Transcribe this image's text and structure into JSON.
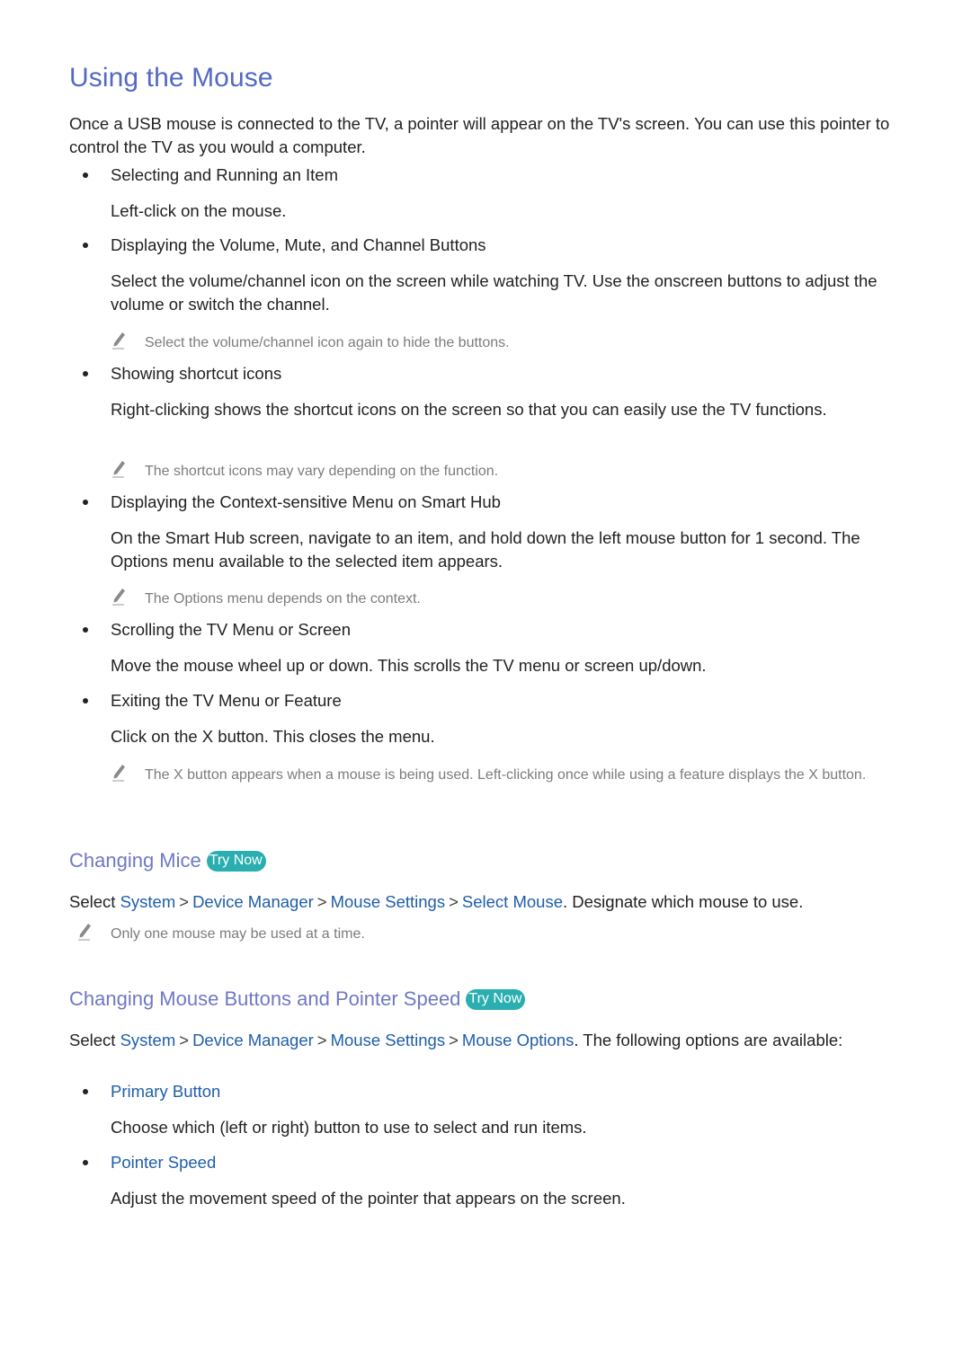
{
  "title": "Using the Mouse",
  "intro": "Once a USB mouse is connected to the TV, a pointer will appear on the TV's screen. You can use this pointer to control the TV as you would a computer.",
  "items": [
    {
      "heading": "Selecting and Running an Item",
      "text": "Left-click on the mouse.",
      "note": ""
    },
    {
      "heading": "Displaying the Volume, Mute, and Channel Buttons",
      "text": "Select the volume/channel icon on the screen while watching TV. Use the onscreen buttons to adjust the volume or switch the channel.",
      "note": "Select the volume/channel icon again to hide the buttons."
    },
    {
      "heading": "Showing shortcut icons",
      "text": "Right-clicking shows the shortcut icons on the screen so that you can easily use the TV functions.",
      "note": "The shortcut icons may vary depending on the function."
    },
    {
      "heading": "Displaying the Context-sensitive Menu on Smart Hub",
      "text": "On the Smart Hub screen, navigate to an item, and hold down the left mouse button for 1 second. The Options menu available to the selected item appears.",
      "note": "The Options menu depends on the context."
    },
    {
      "heading": "Scrolling the TV Menu or Screen",
      "text": "Move the mouse wheel up or down. This scrolls the TV menu or screen up/down.",
      "note": ""
    },
    {
      "heading": "Exiting the TV Menu or Feature",
      "text": "Click on the X button. This closes the menu.",
      "note": "The X button appears when a mouse is being used. Left-clicking once while using a feature displays the X button."
    }
  ],
  "section_mice": {
    "title": "Changing Mice",
    "try_now": "Try Now",
    "select_label": "Select",
    "path": [
      "System",
      "Device Manager",
      "Mouse Settings",
      "Select Mouse"
    ],
    "separator": ">",
    "suffix": ". Designate which mouse to use.",
    "note": "Only one mouse may be used at a time."
  },
  "section_buttons": {
    "title": "Changing Mouse Buttons and Pointer Speed",
    "try_now": "Try Now",
    "select_label": "Select",
    "path": [
      "System",
      "Device Manager",
      "Mouse Settings",
      "Mouse Options"
    ],
    "separator": ">",
    "suffix": ". The following options are available:",
    "options": [
      {
        "name": "Primary Button",
        "text": "Choose which (left or right) button to use to select and run items."
      },
      {
        "name": "Pointer Speed",
        "text": "Adjust the movement speed of the pointer that appears on the screen."
      }
    ]
  },
  "colors": {
    "title": "#5469c3",
    "subtitle": "#6f79c2",
    "link": "#1f5ea8",
    "try_now": "#2aaeb0",
    "note": "#7c7c7c"
  }
}
